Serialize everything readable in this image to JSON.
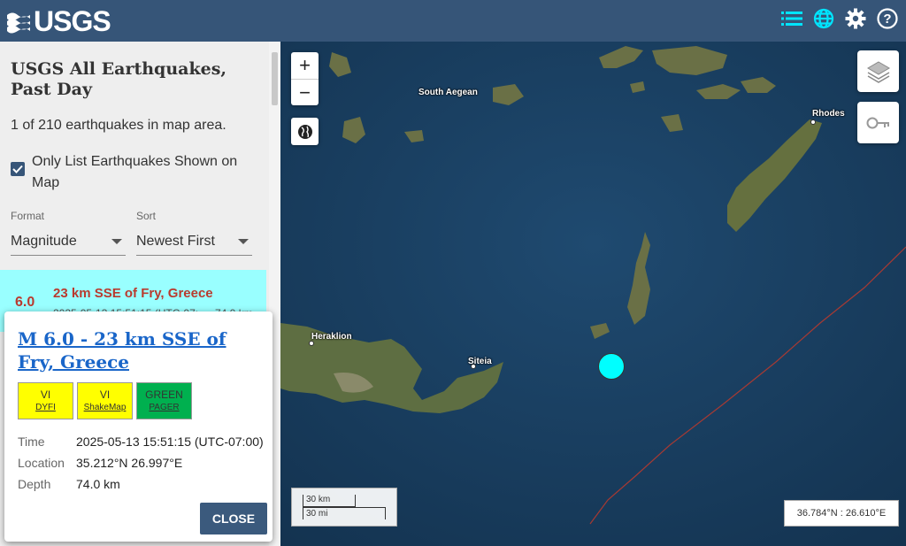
{
  "header": {
    "logo_text": "USGS",
    "icons": [
      "list-icon",
      "globe-icon",
      "gear-icon",
      "help-icon"
    ]
  },
  "sidebar": {
    "title": "USGS All Earthquakes, Past Day",
    "count_text": "1 of 210 earthquakes in map area.",
    "only_list_label": "Only List Earthquakes Shown on Map",
    "only_list_checked": true,
    "format": {
      "label": "Format",
      "value": "Magnitude"
    },
    "sort": {
      "label": "Sort",
      "value": "Newest First"
    },
    "earthquake": {
      "magnitude": "6.0",
      "place": "23 km SSE of Fry, Greece",
      "time": "2025-05-13 15:51:15 (UTC-07:",
      "depth": "74.0 km"
    }
  },
  "map": {
    "labels": {
      "south_aegean": "South Aegean",
      "rhodes": "Rhodes",
      "heraklion": "Heraklion",
      "siteia": "Siteia"
    },
    "scale_km": "30 km",
    "scale_mi": "30 mi",
    "coordinates": "36.784°N : 26.610°E",
    "quake_color": "#00ffff"
  },
  "popup": {
    "title": "M 6.0 - 23 km SSE of Fry, Greece",
    "badges": [
      {
        "level": "VI",
        "name": "DYFI",
        "color": "#ffff00"
      },
      {
        "level": "VI",
        "name": "ShakeMap",
        "color": "#ffff00"
      },
      {
        "level": "GREEN",
        "name": "PAGER",
        "color": "#00b04f"
      }
    ],
    "time_label": "Time",
    "time_value": "2025-05-13 15:51:15 (UTC-07:00)",
    "location_label": "Location",
    "location_value": "35.212°N 26.997°E",
    "depth_label": "Depth",
    "depth_value": "74.0 km",
    "close_label": "CLOSE"
  }
}
